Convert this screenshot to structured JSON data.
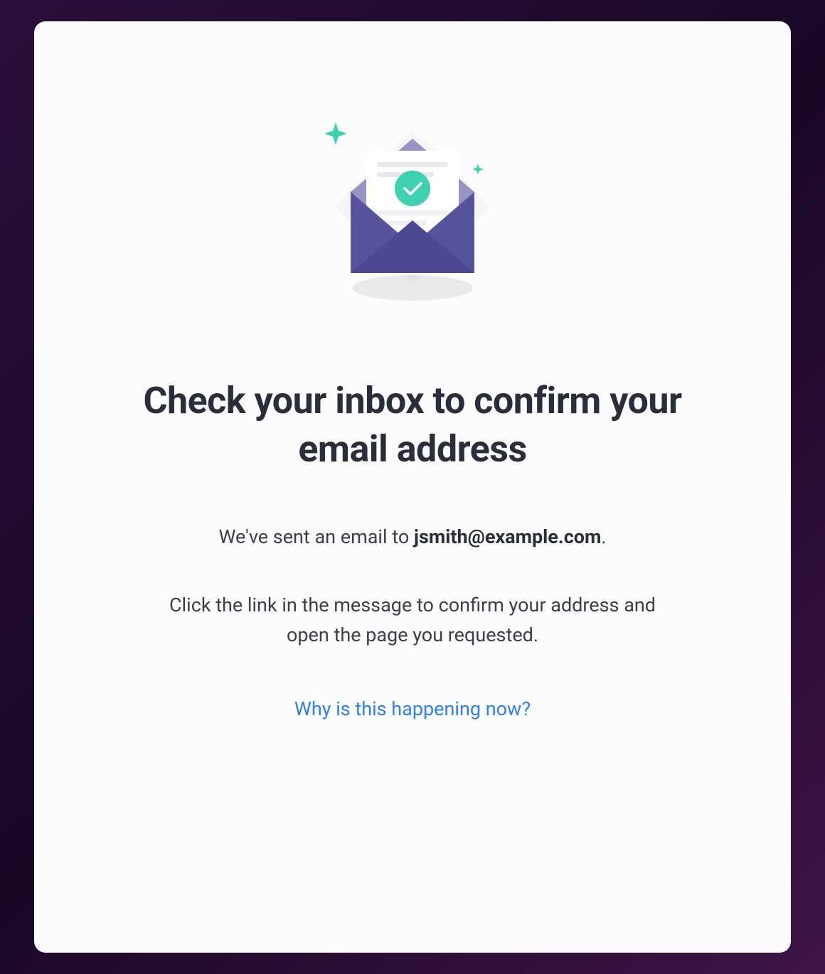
{
  "card": {
    "heading": "Check your inbox to confirm your email address",
    "sent_prefix": "We've sent an email to ",
    "email": "jsmith@example.com",
    "sent_suffix": ".",
    "instruction": "Click the link in the message to confirm your address and open the page you requested.",
    "help_link": "Why is this happening now?"
  },
  "colors": {
    "envelope_dark": "#4c4a8f",
    "envelope_light": "#5a58a0",
    "envelope_mid": "#6a68b5",
    "paper": "#ffffff",
    "check_circle": "#3dd1b0",
    "sparkle": "#3dd1b0",
    "line": "#e6e7ea"
  }
}
